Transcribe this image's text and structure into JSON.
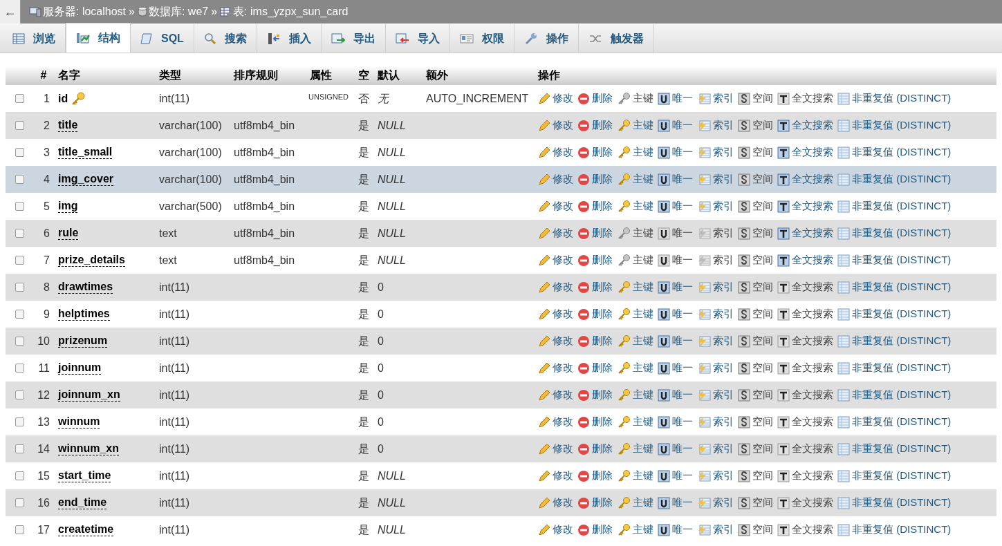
{
  "back_button": "←",
  "breadcrumb": [
    {
      "kind": "server",
      "label": "服务器: localhost"
    },
    {
      "kind": "sep",
      "label": "»"
    },
    {
      "kind": "database",
      "label": "数据库: we7"
    },
    {
      "kind": "sep",
      "label": "»"
    },
    {
      "kind": "table",
      "label": "表: ims_yzpx_sun_card"
    }
  ],
  "tabs": [
    {
      "kind": "browse",
      "label": "浏览",
      "selected": false
    },
    {
      "kind": "structure",
      "label": "结构",
      "selected": true
    },
    {
      "kind": "sql",
      "label": "SQL",
      "selected": false
    },
    {
      "kind": "search",
      "label": "搜索",
      "selected": false
    },
    {
      "kind": "insert",
      "label": "插入",
      "selected": false
    },
    {
      "kind": "export",
      "label": "导出",
      "selected": false
    },
    {
      "kind": "import",
      "label": "导入",
      "selected": false
    },
    {
      "kind": "privileges",
      "label": "权限",
      "selected": false
    },
    {
      "kind": "operations",
      "label": "操作",
      "selected": false
    },
    {
      "kind": "triggers",
      "label": "触发器",
      "selected": false
    }
  ],
  "table": {
    "columns": [
      "#",
      "名字",
      "类型",
      "排序规则",
      "属性",
      "空",
      "默认",
      "额外",
      "操作"
    ],
    "rows": [
      {
        "num": "1",
        "name": "id",
        "primary": true,
        "type": "int(11)",
        "attributes": "UNSIGNED",
        "null": "否",
        "default": "无",
        "default_italic": true,
        "extra": "AUTO_INCREMENT",
        "selected": false,
        "checked": false,
        "actions": [
          {
            "kind": "edit",
            "label": "修改",
            "disabled": false
          },
          {
            "kind": "drop",
            "label": "删除",
            "disabled": false
          },
          {
            "kind": "primary",
            "label": "主键",
            "disabled": true
          },
          {
            "kind": "unique",
            "label": "唯一",
            "disabled": false
          },
          {
            "kind": "index",
            "label": "索引",
            "disabled": false
          },
          {
            "kind": "spatial",
            "label": "空间",
            "disabled": true
          },
          {
            "kind": "fulltext",
            "label": "全文搜索",
            "disabled": true
          },
          {
            "kind": "distinct",
            "label": "非重复值 (DISTINCT)",
            "disabled": false
          }
        ]
      },
      {
        "num": "2",
        "name": "title",
        "primary": false,
        "type": "varchar(100)",
        "collation": "utf8mb4_bin",
        "null": "是",
        "default": "NULL",
        "default_italic": true,
        "selected": false,
        "checked": false,
        "actions": [
          {
            "kind": "edit",
            "label": "修改",
            "disabled": false
          },
          {
            "kind": "drop",
            "label": "删除",
            "disabled": false
          },
          {
            "kind": "primary",
            "label": "主键",
            "disabled": false
          },
          {
            "kind": "unique",
            "label": "唯一",
            "disabled": false
          },
          {
            "kind": "index",
            "label": "索引",
            "disabled": false
          },
          {
            "kind": "spatial",
            "label": "空间",
            "disabled": true
          },
          {
            "kind": "fulltext",
            "label": "全文搜索",
            "disabled": false
          },
          {
            "kind": "distinct",
            "label": "非重复值 (DISTINCT)",
            "disabled": false
          }
        ]
      },
      {
        "num": "3",
        "name": "title_small",
        "primary": false,
        "type": "varchar(100)",
        "collation": "utf8mb4_bin",
        "null": "是",
        "default": "NULL",
        "default_italic": true,
        "selected": false,
        "checked": false,
        "actions": [
          {
            "kind": "edit",
            "label": "修改",
            "disabled": false
          },
          {
            "kind": "drop",
            "label": "删除",
            "disabled": false
          },
          {
            "kind": "primary",
            "label": "主键",
            "disabled": false
          },
          {
            "kind": "unique",
            "label": "唯一",
            "disabled": false
          },
          {
            "kind": "index",
            "label": "索引",
            "disabled": false
          },
          {
            "kind": "spatial",
            "label": "空间",
            "disabled": true
          },
          {
            "kind": "fulltext",
            "label": "全文搜索",
            "disabled": false
          },
          {
            "kind": "distinct",
            "label": "非重复值 (DISTINCT)",
            "disabled": false
          }
        ]
      },
      {
        "num": "4",
        "name": "img_cover",
        "primary": false,
        "type": "varchar(100)",
        "collation": "utf8mb4_bin",
        "null": "是",
        "default": "NULL",
        "default_italic": true,
        "selected": true,
        "checked": false,
        "actions": [
          {
            "kind": "edit",
            "label": "修改",
            "disabled": false
          },
          {
            "kind": "drop",
            "label": "删除",
            "disabled": false
          },
          {
            "kind": "primary",
            "label": "主键",
            "disabled": false
          },
          {
            "kind": "unique",
            "label": "唯一",
            "disabled": false
          },
          {
            "kind": "index",
            "label": "索引",
            "disabled": false
          },
          {
            "kind": "spatial",
            "label": "空间",
            "disabled": true
          },
          {
            "kind": "fulltext",
            "label": "全文搜索",
            "disabled": false
          },
          {
            "kind": "distinct",
            "label": "非重复值 (DISTINCT)",
            "disabled": false
          }
        ]
      },
      {
        "num": "5",
        "name": "img",
        "primary": false,
        "type": "varchar(500)",
        "collation": "utf8mb4_bin",
        "null": "是",
        "default": "NULL",
        "default_italic": true,
        "selected": false,
        "checked": false,
        "actions": [
          {
            "kind": "edit",
            "label": "修改",
            "disabled": false
          },
          {
            "kind": "drop",
            "label": "删除",
            "disabled": false
          },
          {
            "kind": "primary",
            "label": "主键",
            "disabled": false
          },
          {
            "kind": "unique",
            "label": "唯一",
            "disabled": false
          },
          {
            "kind": "index",
            "label": "索引",
            "disabled": false
          },
          {
            "kind": "spatial",
            "label": "空间",
            "disabled": true
          },
          {
            "kind": "fulltext",
            "label": "全文搜索",
            "disabled": false
          },
          {
            "kind": "distinct",
            "label": "非重复值 (DISTINCT)",
            "disabled": false
          }
        ]
      },
      {
        "num": "6",
        "name": "rule",
        "primary": false,
        "type": "text",
        "collation": "utf8mb4_bin",
        "null": "是",
        "default": "NULL",
        "default_italic": true,
        "selected": false,
        "checked": false,
        "actions": [
          {
            "kind": "edit",
            "label": "修改",
            "disabled": false
          },
          {
            "kind": "drop",
            "label": "删除",
            "disabled": false
          },
          {
            "kind": "primary",
            "label": "主键",
            "disabled": true
          },
          {
            "kind": "unique",
            "label": "唯一",
            "disabled": true
          },
          {
            "kind": "index",
            "label": "索引",
            "disabled": true
          },
          {
            "kind": "spatial",
            "label": "空间",
            "disabled": true
          },
          {
            "kind": "fulltext",
            "label": "全文搜索",
            "disabled": false
          },
          {
            "kind": "distinct",
            "label": "非重复值 (DISTINCT)",
            "disabled": false
          }
        ]
      },
      {
        "num": "7",
        "name": "prize_details",
        "primary": false,
        "type": "text",
        "collation": "utf8mb4_bin",
        "null": "是",
        "default": "NULL",
        "default_italic": true,
        "selected": false,
        "checked": false,
        "actions": [
          {
            "kind": "edit",
            "label": "修改",
            "disabled": false
          },
          {
            "kind": "drop",
            "label": "删除",
            "disabled": false
          },
          {
            "kind": "primary",
            "label": "主键",
            "disabled": true
          },
          {
            "kind": "unique",
            "label": "唯一",
            "disabled": true
          },
          {
            "kind": "index",
            "label": "索引",
            "disabled": true
          },
          {
            "kind": "spatial",
            "label": "空间",
            "disabled": true
          },
          {
            "kind": "fulltext",
            "label": "全文搜索",
            "disabled": false
          },
          {
            "kind": "distinct",
            "label": "非重复值 (DISTINCT)",
            "disabled": false
          }
        ]
      },
      {
        "num": "8",
        "name": "drawtimes",
        "primary": false,
        "type": "int(11)",
        "null": "是",
        "default": "0",
        "default_italic": false,
        "selected": false,
        "checked": false,
        "actions": [
          {
            "kind": "edit",
            "label": "修改",
            "disabled": false
          },
          {
            "kind": "drop",
            "label": "删除",
            "disabled": false
          },
          {
            "kind": "primary",
            "label": "主键",
            "disabled": false
          },
          {
            "kind": "unique",
            "label": "唯一",
            "disabled": false
          },
          {
            "kind": "index",
            "label": "索引",
            "disabled": false
          },
          {
            "kind": "spatial",
            "label": "空间",
            "disabled": true
          },
          {
            "kind": "fulltext",
            "label": "全文搜索",
            "disabled": true
          },
          {
            "kind": "distinct",
            "label": "非重复值 (DISTINCT)",
            "disabled": false
          }
        ]
      },
      {
        "num": "9",
        "name": "helptimes",
        "primary": false,
        "type": "int(11)",
        "null": "是",
        "default": "0",
        "default_italic": false,
        "selected": false,
        "checked": false,
        "actions": [
          {
            "kind": "edit",
            "label": "修改",
            "disabled": false
          },
          {
            "kind": "drop",
            "label": "删除",
            "disabled": false
          },
          {
            "kind": "primary",
            "label": "主键",
            "disabled": false
          },
          {
            "kind": "unique",
            "label": "唯一",
            "disabled": false
          },
          {
            "kind": "index",
            "label": "索引",
            "disabled": false
          },
          {
            "kind": "spatial",
            "label": "空间",
            "disabled": true
          },
          {
            "kind": "fulltext",
            "label": "全文搜索",
            "disabled": true
          },
          {
            "kind": "distinct",
            "label": "非重复值 (DISTINCT)",
            "disabled": false
          }
        ]
      },
      {
        "num": "10",
        "name": "prizenum",
        "primary": false,
        "type": "int(11)",
        "null": "是",
        "default": "0",
        "default_italic": false,
        "selected": false,
        "checked": false,
        "actions": [
          {
            "kind": "edit",
            "label": "修改",
            "disabled": false
          },
          {
            "kind": "drop",
            "label": "删除",
            "disabled": false
          },
          {
            "kind": "primary",
            "label": "主键",
            "disabled": false
          },
          {
            "kind": "unique",
            "label": "唯一",
            "disabled": false
          },
          {
            "kind": "index",
            "label": "索引",
            "disabled": false
          },
          {
            "kind": "spatial",
            "label": "空间",
            "disabled": true
          },
          {
            "kind": "fulltext",
            "label": "全文搜索",
            "disabled": true
          },
          {
            "kind": "distinct",
            "label": "非重复值 (DISTINCT)",
            "disabled": false
          }
        ]
      },
      {
        "num": "11",
        "name": "joinnum",
        "primary": false,
        "type": "int(11)",
        "null": "是",
        "default": "0",
        "default_italic": false,
        "selected": false,
        "checked": false,
        "actions": [
          {
            "kind": "edit",
            "label": "修改",
            "disabled": false
          },
          {
            "kind": "drop",
            "label": "删除",
            "disabled": false
          },
          {
            "kind": "primary",
            "label": "主键",
            "disabled": false
          },
          {
            "kind": "unique",
            "label": "唯一",
            "disabled": false
          },
          {
            "kind": "index",
            "label": "索引",
            "disabled": false
          },
          {
            "kind": "spatial",
            "label": "空间",
            "disabled": true
          },
          {
            "kind": "fulltext",
            "label": "全文搜索",
            "disabled": true
          },
          {
            "kind": "distinct",
            "label": "非重复值 (DISTINCT)",
            "disabled": false
          }
        ]
      },
      {
        "num": "12",
        "name": "joinnum_xn",
        "primary": false,
        "type": "int(11)",
        "null": "是",
        "default": "0",
        "default_italic": false,
        "selected": false,
        "checked": false,
        "actions": [
          {
            "kind": "edit",
            "label": "修改",
            "disabled": false
          },
          {
            "kind": "drop",
            "label": "删除",
            "disabled": false
          },
          {
            "kind": "primary",
            "label": "主键",
            "disabled": false
          },
          {
            "kind": "unique",
            "label": "唯一",
            "disabled": false
          },
          {
            "kind": "index",
            "label": "索引",
            "disabled": false
          },
          {
            "kind": "spatial",
            "label": "空间",
            "disabled": true
          },
          {
            "kind": "fulltext",
            "label": "全文搜索",
            "disabled": true
          },
          {
            "kind": "distinct",
            "label": "非重复值 (DISTINCT)",
            "disabled": false
          }
        ]
      },
      {
        "num": "13",
        "name": "winnum",
        "primary": false,
        "type": "int(11)",
        "null": "是",
        "default": "0",
        "default_italic": false,
        "selected": false,
        "checked": false,
        "actions": [
          {
            "kind": "edit",
            "label": "修改",
            "disabled": false
          },
          {
            "kind": "drop",
            "label": "删除",
            "disabled": false
          },
          {
            "kind": "primary",
            "label": "主键",
            "disabled": false
          },
          {
            "kind": "unique",
            "label": "唯一",
            "disabled": false
          },
          {
            "kind": "index",
            "label": "索引",
            "disabled": false
          },
          {
            "kind": "spatial",
            "label": "空间",
            "disabled": true
          },
          {
            "kind": "fulltext",
            "label": "全文搜索",
            "disabled": true
          },
          {
            "kind": "distinct",
            "label": "非重复值 (DISTINCT)",
            "disabled": false
          }
        ]
      },
      {
        "num": "14",
        "name": "winnum_xn",
        "primary": false,
        "type": "int(11)",
        "null": "是",
        "default": "0",
        "default_italic": false,
        "selected": false,
        "checked": false,
        "actions": [
          {
            "kind": "edit",
            "label": "修改",
            "disabled": false
          },
          {
            "kind": "drop",
            "label": "删除",
            "disabled": false
          },
          {
            "kind": "primary",
            "label": "主键",
            "disabled": false
          },
          {
            "kind": "unique",
            "label": "唯一",
            "disabled": false
          },
          {
            "kind": "index",
            "label": "索引",
            "disabled": false
          },
          {
            "kind": "spatial",
            "label": "空间",
            "disabled": true
          },
          {
            "kind": "fulltext",
            "label": "全文搜索",
            "disabled": true
          },
          {
            "kind": "distinct",
            "label": "非重复值 (DISTINCT)",
            "disabled": false
          }
        ]
      },
      {
        "num": "15",
        "name": "start_time",
        "primary": false,
        "type": "int(11)",
        "null": "是",
        "default": "NULL",
        "default_italic": true,
        "selected": false,
        "checked": false,
        "actions": [
          {
            "kind": "edit",
            "label": "修改",
            "disabled": false
          },
          {
            "kind": "drop",
            "label": "删除",
            "disabled": false
          },
          {
            "kind": "primary",
            "label": "主键",
            "disabled": false
          },
          {
            "kind": "unique",
            "label": "唯一",
            "disabled": false
          },
          {
            "kind": "index",
            "label": "索引",
            "disabled": false
          },
          {
            "kind": "spatial",
            "label": "空间",
            "disabled": true
          },
          {
            "kind": "fulltext",
            "label": "全文搜索",
            "disabled": true
          },
          {
            "kind": "distinct",
            "label": "非重复值 (DISTINCT)",
            "disabled": false
          }
        ]
      },
      {
        "num": "16",
        "name": "end_time",
        "primary": false,
        "type": "int(11)",
        "null": "是",
        "default": "NULL",
        "default_italic": true,
        "selected": false,
        "checked": false,
        "actions": [
          {
            "kind": "edit",
            "label": "修改",
            "disabled": false
          },
          {
            "kind": "drop",
            "label": "删除",
            "disabled": false
          },
          {
            "kind": "primary",
            "label": "主键",
            "disabled": false
          },
          {
            "kind": "unique",
            "label": "唯一",
            "disabled": false
          },
          {
            "kind": "index",
            "label": "索引",
            "disabled": false
          },
          {
            "kind": "spatial",
            "label": "空间",
            "disabled": true
          },
          {
            "kind": "fulltext",
            "label": "全文搜索",
            "disabled": true
          },
          {
            "kind": "distinct",
            "label": "非重复值 (DISTINCT)",
            "disabled": false
          }
        ]
      },
      {
        "num": "17",
        "name": "createtime",
        "primary": false,
        "type": "int(11)",
        "null": "是",
        "default": "NULL",
        "default_italic": true,
        "selected": false,
        "checked": false,
        "actions": [
          {
            "kind": "edit",
            "label": "修改",
            "disabled": false
          },
          {
            "kind": "drop",
            "label": "删除",
            "disabled": false
          },
          {
            "kind": "primary",
            "label": "主键",
            "disabled": false
          },
          {
            "kind": "unique",
            "label": "唯一",
            "disabled": false
          },
          {
            "kind": "index",
            "label": "索引",
            "disabled": false
          },
          {
            "kind": "spatial",
            "label": "空间",
            "disabled": true
          },
          {
            "kind": "fulltext",
            "label": "全文搜索",
            "disabled": true
          },
          {
            "kind": "distinct",
            "label": "非重复值 (DISTINCT)",
            "disabled": false
          }
        ]
      }
    ]
  }
}
